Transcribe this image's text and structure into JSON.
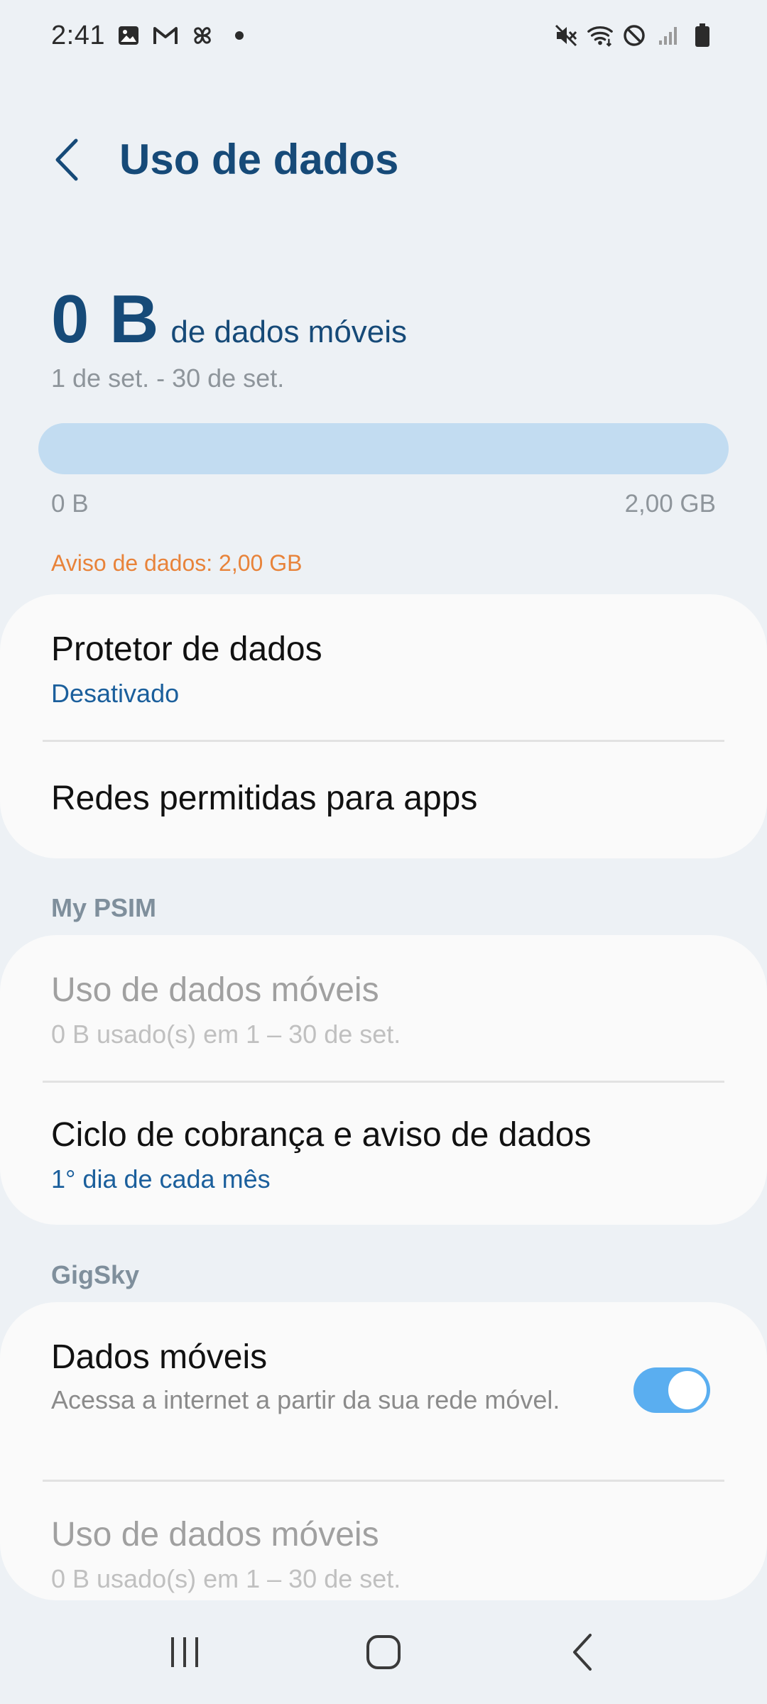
{
  "status_bar": {
    "time": "2:41",
    "left_icons": [
      "image-icon",
      "gmail-icon",
      "pinwheel-icon",
      "dot-icon"
    ],
    "right_icons": [
      "mute-icon",
      "wifi-icon",
      "block-icon",
      "signal-icon",
      "battery-icon"
    ]
  },
  "header": {
    "title": "Uso de dados"
  },
  "usage": {
    "amount": "0 B",
    "suffix": "de dados móveis",
    "period": "1 de set. - 30 de set.",
    "bar_fraction": 0,
    "bar_min": "0 B",
    "bar_max": "2,00 GB",
    "warning": "Aviso de dados: 2,00 GB"
  },
  "general": {
    "data_saver": {
      "title": "Protetor de dados",
      "status": "Desativado"
    },
    "allowed_networks": {
      "title": "Redes permitidas para apps"
    }
  },
  "sim1": {
    "name": "My PSIM",
    "mobile_usage": {
      "title": "Uso de dados móveis",
      "subtitle": "0 B usado(s) em 1 – 30 de set."
    },
    "billing": {
      "title": "Ciclo de cobrança e aviso de dados",
      "subtitle": "1° dia de cada mês"
    }
  },
  "sim2": {
    "name": "GigSky",
    "mobile_data": {
      "title": "Dados móveis",
      "subtitle": "Acessa a internet a partir da sua rede móvel.",
      "enabled": true
    },
    "mobile_usage": {
      "title": "Uso de dados móveis",
      "subtitle": "0 B usado(s) em 1 – 30 de set."
    }
  },
  "colors": {
    "accent": "#164a78",
    "link": "#1b5f9c",
    "warning": "#e8833a",
    "bar": "#c2dcf1",
    "toggle_on": "#5aaef0"
  },
  "nav_bar": {
    "icons": [
      "recents-icon",
      "home-icon",
      "back-icon"
    ]
  }
}
